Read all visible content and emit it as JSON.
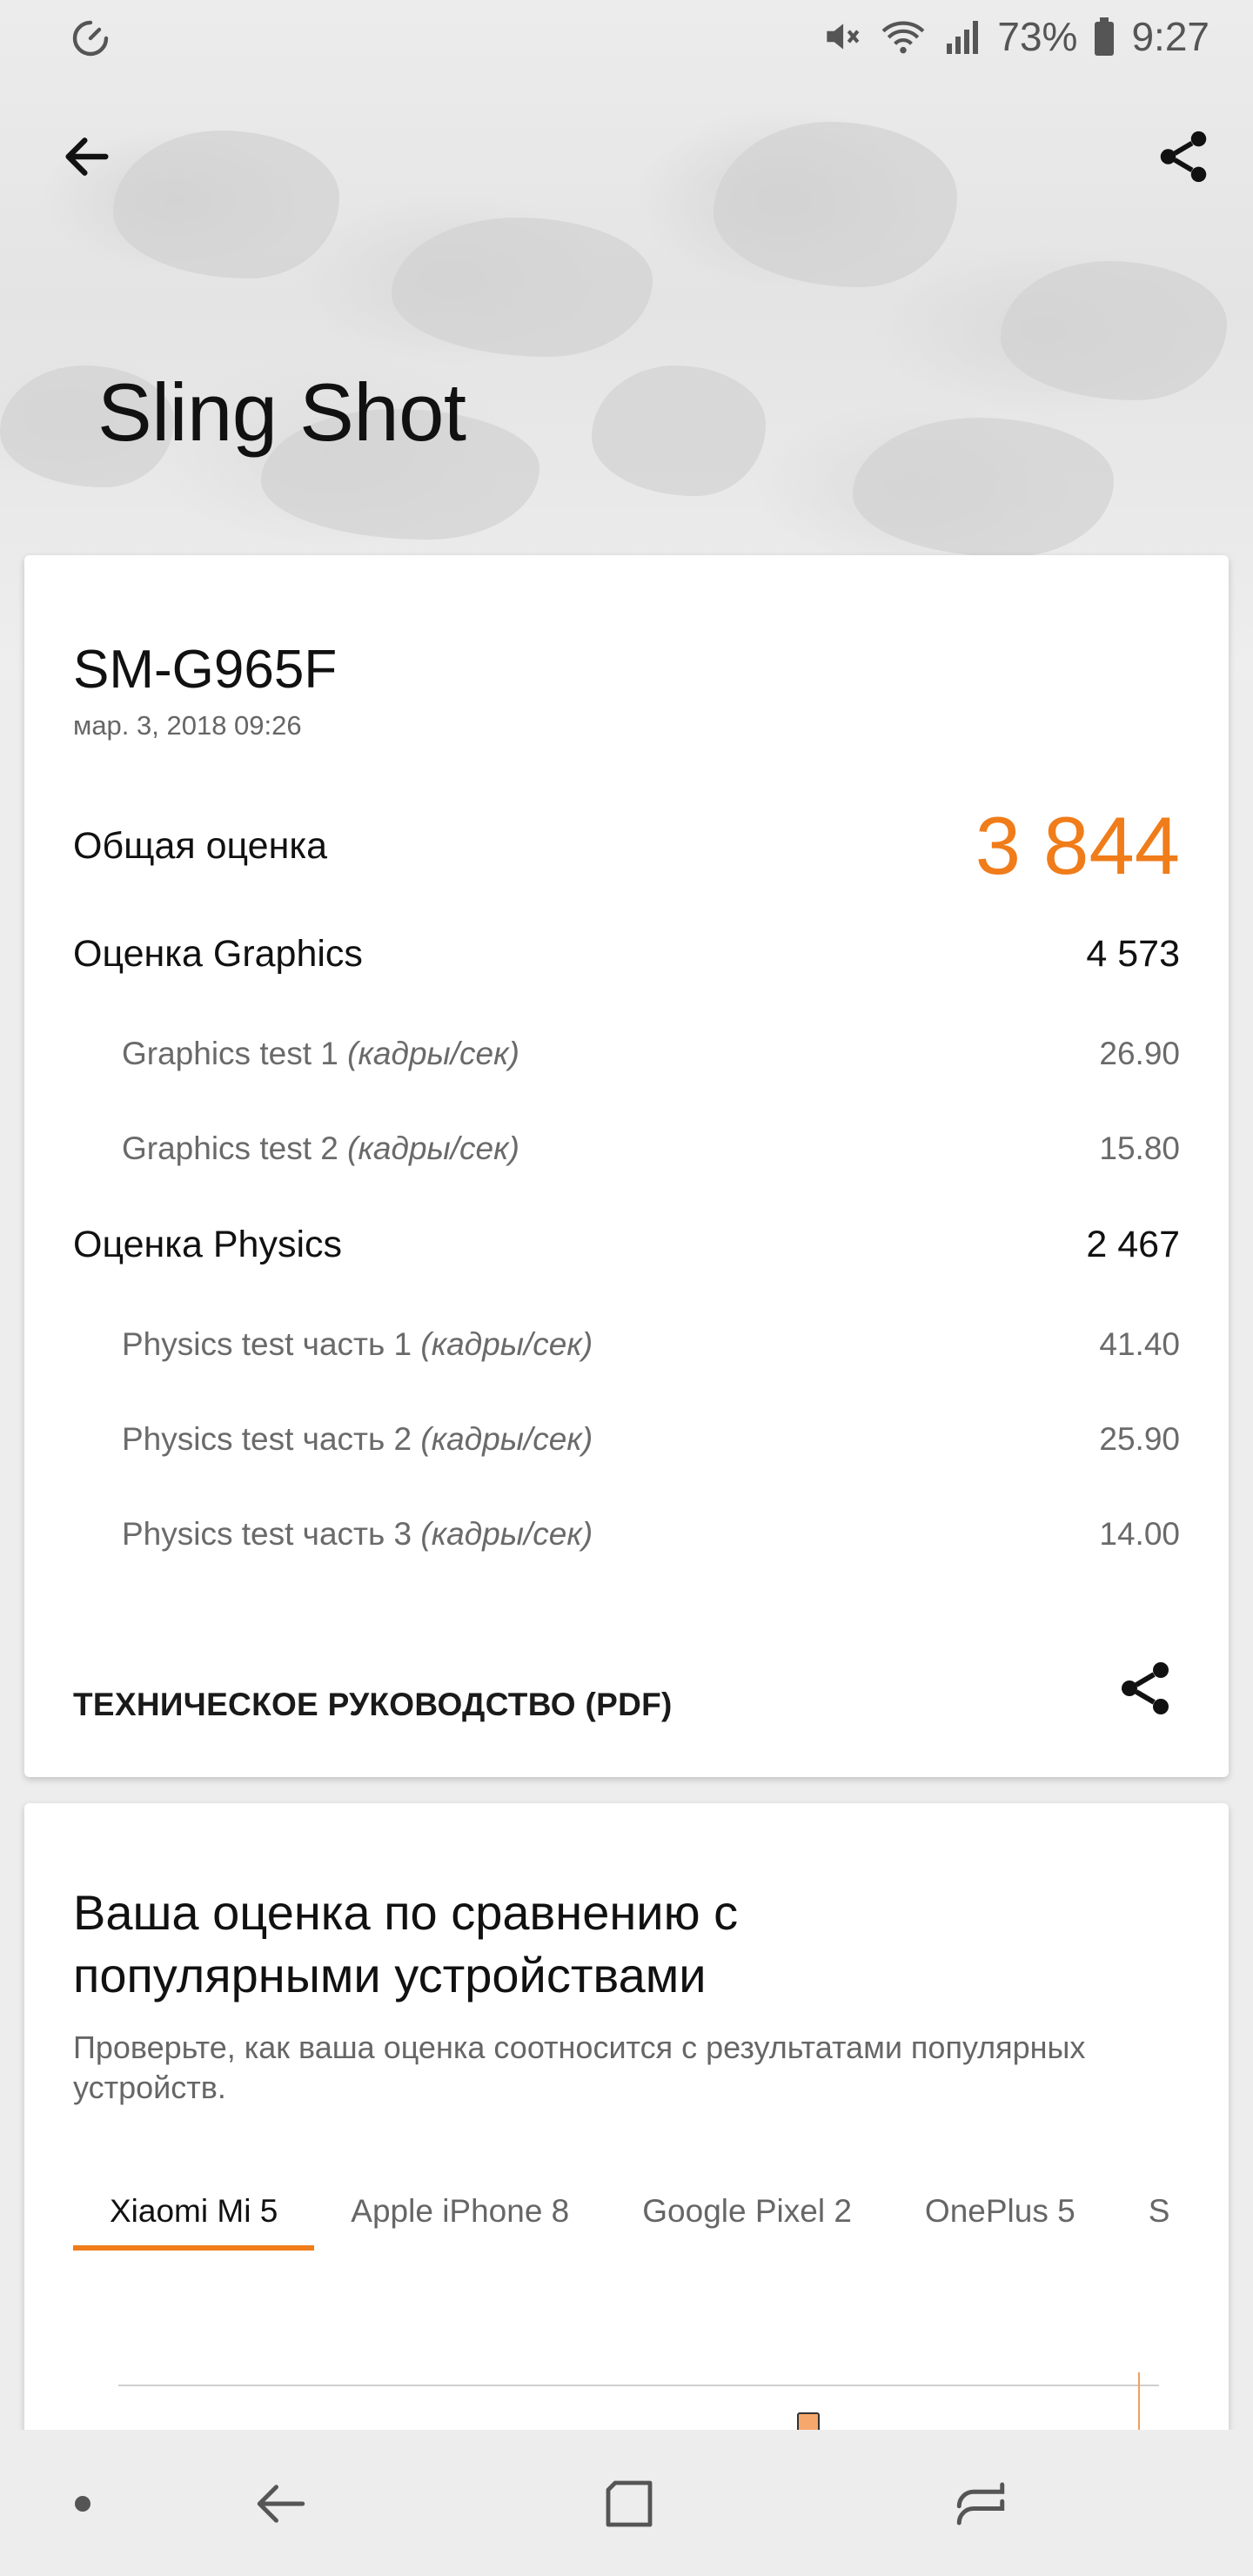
{
  "status_bar": {
    "battery": "73%",
    "time": "9:27",
    "left_icon": "speedometer-icon",
    "icons": [
      "mute-icon",
      "wifi-icon",
      "signal-icon",
      "battery-icon"
    ]
  },
  "header": {
    "title": "Sling Shot",
    "back_icon": "arrow-left-icon",
    "share_icon": "share-icon"
  },
  "result_card": {
    "device": "SM-G965F",
    "date": "мар. 3, 2018 09:26",
    "total_label": "Общая оценка",
    "total_value": "3 844",
    "graphics": {
      "label": "Оценка Graphics",
      "value": "4 573",
      "tests": [
        {
          "label": "Graphics test 1",
          "unit": "(кадры/сек)",
          "value": "26.90"
        },
        {
          "label": "Graphics test 2",
          "unit": "(кадры/сек)",
          "value": "15.80"
        }
      ]
    },
    "physics": {
      "label": "Оценка Physics",
      "value": "2 467",
      "tests": [
        {
          "label": "Physics test часть 1",
          "unit": "(кадры/сек)",
          "value": "41.40"
        },
        {
          "label": "Physics test часть 2",
          "unit": "(кадры/сек)",
          "value": "25.90"
        },
        {
          "label": "Physics test часть 3",
          "unit": "(кадры/сек)",
          "value": "14.00"
        }
      ]
    },
    "tech_guide_link": "ТЕХНИЧЕСКОЕ РУКОВОДСТВО (PDF)",
    "accent_color": "#f07c1a"
  },
  "compare_card": {
    "title": "Ваша оценка по сравнению с популярными устройствами",
    "subtitle": "Проверьте, как ваша оценка соотносится с результатами популярных устройств.",
    "tabs": [
      "Xiaomi Mi 5",
      "Apple iPhone 8",
      "Google Pixel 2",
      "OnePlus 5",
      "S"
    ],
    "active_tab": "Xiaomi Mi 5"
  },
  "nav_bar": {
    "icons": [
      "dot-icon",
      "back-nav-icon",
      "home-nav-icon",
      "recent-apps-icon"
    ]
  }
}
